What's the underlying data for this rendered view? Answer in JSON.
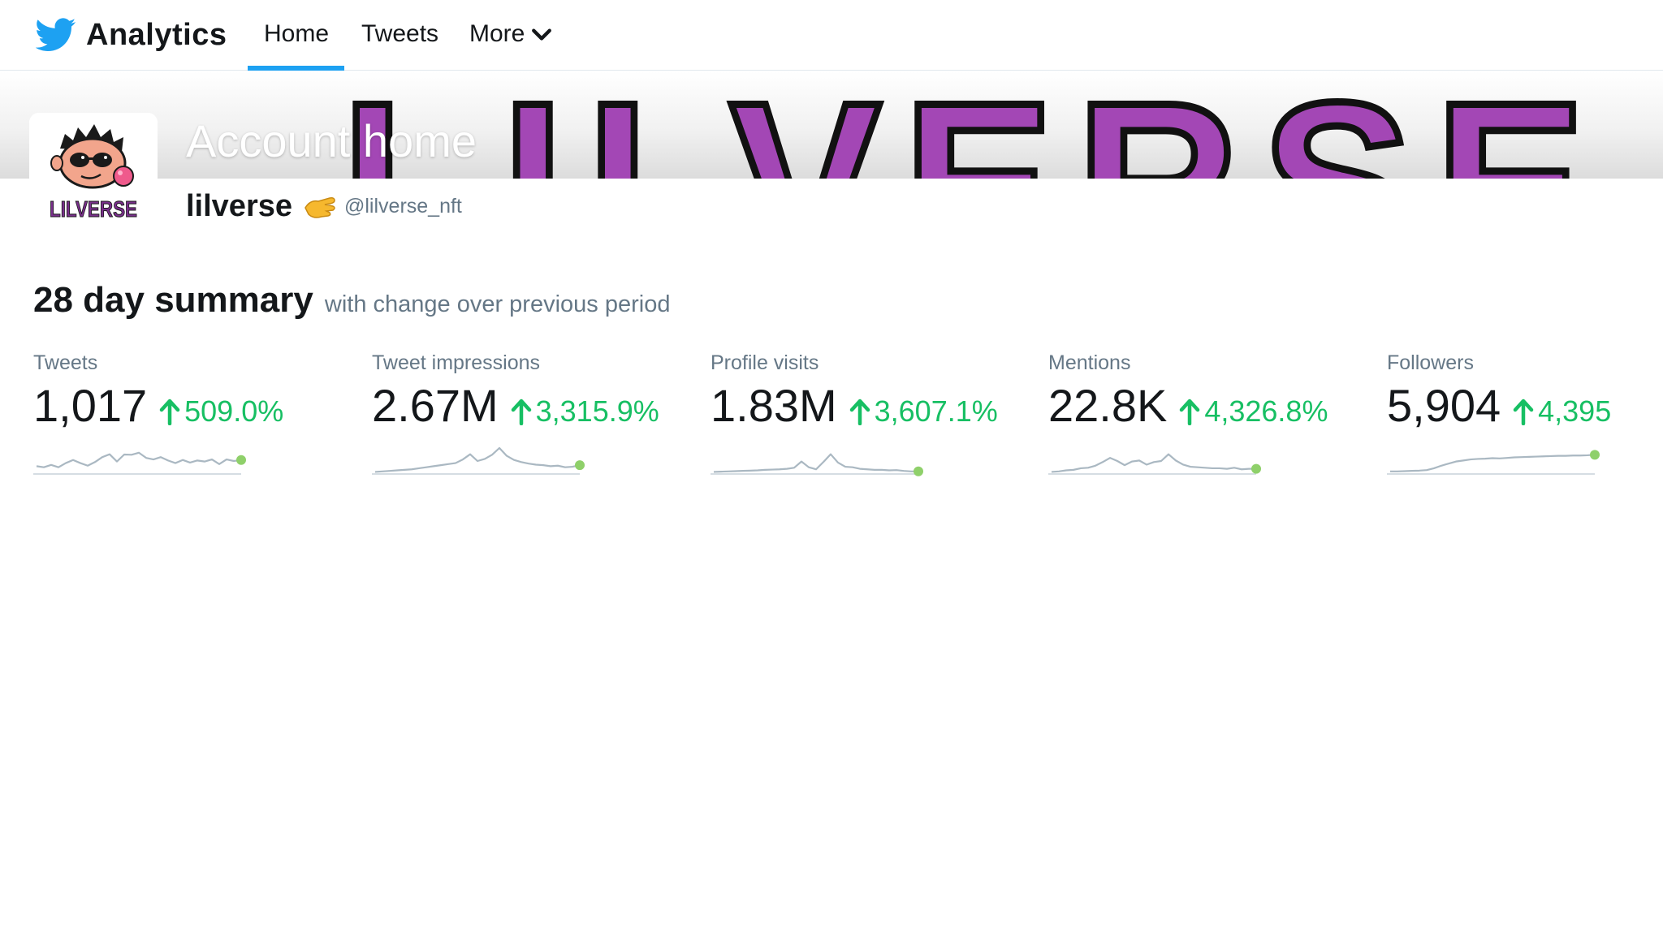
{
  "nav": {
    "brand": "Analytics",
    "items": [
      {
        "label": "Home",
        "active": true
      },
      {
        "label": "Tweets",
        "active": false
      },
      {
        "label": "More",
        "active": false
      }
    ],
    "active_color": "#1da1f2"
  },
  "header": {
    "title": "Account home",
    "banner_text": "LILVERSE",
    "account_name": "lilverse",
    "account_emoji": "pinching-hand-emoji",
    "handle": "@lilverse_nft",
    "avatar_text": "LILVERSE"
  },
  "summary": {
    "title": "28 day summary",
    "subtitle": "with change over previous period",
    "positive_color": "#17bf63",
    "stats": [
      {
        "label": "Tweets",
        "value": "1,017",
        "change": "509.0%",
        "trend": [
          3,
          2.6,
          3.5,
          2.6,
          4.2,
          5.4,
          4.2,
          3.2,
          4.6,
          6.5,
          7.6,
          4.8,
          7.5,
          7.4,
          8.2,
          6.2,
          5.6,
          6.5,
          5.2,
          4.2,
          5.4,
          4.4,
          5.2,
          4.8,
          5.6,
          3.8,
          5.6,
          5.0,
          5.4
        ]
      },
      {
        "label": "Tweet impressions",
        "value": "2.67M",
        "change": "3,315.9%",
        "trend": [
          0.8,
          1.0,
          1.2,
          1.4,
          1.6,
          1.8,
          2.2,
          2.6,
          3.0,
          3.4,
          3.8,
          4.2,
          5.6,
          7.6,
          5.0,
          5.8,
          7.4,
          10.0,
          7.0,
          5.4,
          4.6,
          4.0,
          3.6,
          3.4,
          3.0,
          3.2,
          2.6,
          2.8,
          3.4
        ]
      },
      {
        "label": "Profile visits",
        "value": "1.83M",
        "change": "3,607.1%",
        "trend": [
          0.8,
          0.9,
          1.0,
          1.1,
          1.2,
          1.3,
          1.4,
          1.6,
          1.7,
          1.8,
          2.0,
          2.4,
          4.8,
          2.6,
          1.8,
          4.6,
          7.6,
          4.4,
          2.8,
          2.6,
          2.0,
          1.8,
          1.6,
          1.6,
          1.4,
          1.5,
          1.2,
          1.0,
          1.0
        ]
      },
      {
        "label": "Mentions",
        "value": "22.8K",
        "change": "4,326.8%",
        "trend": [
          0.8,
          1.0,
          1.4,
          1.6,
          2.2,
          2.4,
          3.2,
          4.6,
          6.2,
          5.0,
          3.4,
          4.8,
          5.2,
          3.6,
          4.6,
          5.0,
          7.6,
          5.2,
          3.6,
          2.8,
          2.6,
          2.4,
          2.2,
          2.2,
          2.0,
          2.4,
          1.8,
          2.0,
          2.0
        ]
      },
      {
        "label": "Followers",
        "value": "5,904",
        "change": "4,395",
        "trend": [
          1.0,
          1.0,
          1.1,
          1.2,
          1.3,
          1.5,
          2.2,
          3.2,
          4.0,
          4.8,
          5.2,
          5.6,
          5.8,
          5.9,
          6.1,
          6.0,
          6.2,
          6.4,
          6.5,
          6.6,
          6.7,
          6.8,
          6.9,
          7.0,
          7.0,
          7.1,
          7.1,
          7.2,
          7.4
        ]
      }
    ]
  }
}
